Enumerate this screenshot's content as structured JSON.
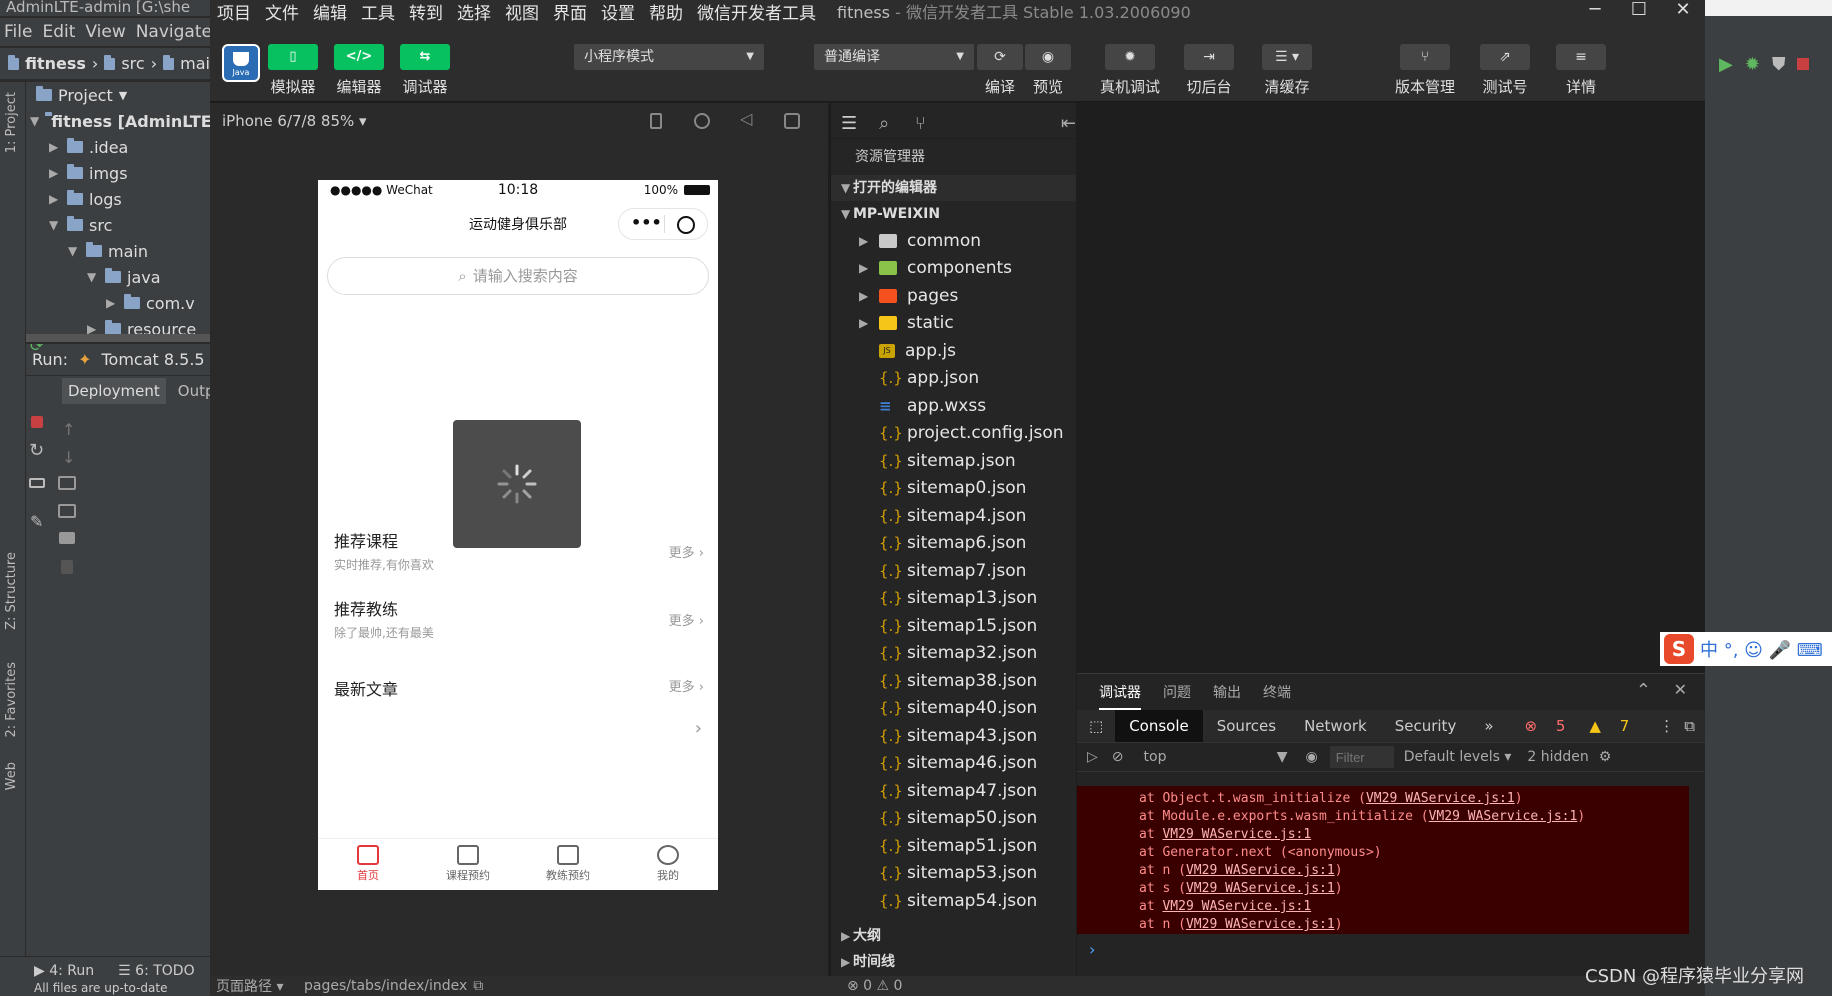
{
  "ij": {
    "titlebar": "AdminLTE-admin [G:\\she",
    "menu": [
      "File",
      "Edit",
      "View",
      "Navigate"
    ],
    "breadcrumb": [
      "fitness",
      "src",
      "mai"
    ],
    "side_labels": [
      "1: Project",
      "Z: Structure",
      "2: Favorites",
      "Web"
    ],
    "project_header": "Project",
    "tree": [
      {
        "label": "fitness [AdminLTE",
        "indent": 0,
        "open": true,
        "bold": true
      },
      {
        "label": ".idea",
        "indent": 1,
        "open": false
      },
      {
        "label": "imgs",
        "indent": 1,
        "open": false
      },
      {
        "label": "logs",
        "indent": 1,
        "open": false
      },
      {
        "label": "src",
        "indent": 1,
        "open": true
      },
      {
        "label": "main",
        "indent": 2,
        "open": true
      },
      {
        "label": "java",
        "indent": 3,
        "open": true
      },
      {
        "label": "com.v",
        "indent": 4,
        "open": false
      },
      {
        "label": "resource",
        "indent": 3,
        "open": false
      }
    ],
    "run_label": "Run:",
    "run_config": "Tomcat 8.5.5",
    "run_tabs": [
      "Deployment",
      "Outpu"
    ],
    "bottom_tabs": [
      "4: Run",
      "6: TODO"
    ],
    "bottom_status": "All files are up-to-date"
  },
  "wx": {
    "menu": [
      "项目",
      "文件",
      "编辑",
      "工具",
      "转到",
      "选择",
      "视图",
      "界面",
      "设置",
      "帮助",
      "微信开发者工具"
    ],
    "title": "fitness",
    "title_sub": " - 微信开发者工具 Stable 1.03.2006090",
    "avatar_text": "Java",
    "toolbar": {
      "simulator": "模拟器",
      "editor": "编辑器",
      "debugger": "调试器",
      "mode_select": "小程序模式",
      "compile_select": "普通编译",
      "compile": "编译",
      "preview": "预览",
      "real_debug": "真机调试",
      "background": "切后台",
      "clear_cache": "清缓存",
      "version": "版本管理",
      "test_account": "测试号",
      "details": "详情"
    },
    "simulator": {
      "device": "iPhone 6/7/8 85% ▾"
    },
    "phone": {
      "carrier": "●●●●● WeChat",
      "time": "10:18",
      "battery": "100%",
      "nav_title": "运动健身俱乐部",
      "search_placeholder": "请输入搜索内容",
      "sections": [
        {
          "title": "推荐课程",
          "subtitle": "实时推荐,有你喜欢",
          "more": "更多"
        },
        {
          "title": "推荐教练",
          "subtitle": "除了最帅,还有最美",
          "more": "更多"
        },
        {
          "title": "最新文章",
          "subtitle": "",
          "more": "更多"
        }
      ],
      "tabs": [
        "首页",
        "课程预约",
        "教练预约",
        "我的"
      ]
    },
    "explorer": {
      "title": "资源管理器",
      "open_editors": "打开的编辑器",
      "project": "MP-WEIXIN",
      "folders": [
        "common",
        "components",
        "pages",
        "static"
      ],
      "folder_colors": [
        "#c9c9c9",
        "#8bc34a",
        "#f4511e",
        "#f5c518"
      ],
      "files": [
        {
          "name": "app.js",
          "type": "js"
        },
        {
          "name": "app.json",
          "type": "json"
        },
        {
          "name": "app.wxss",
          "type": "wxss"
        },
        {
          "name": "project.config.json",
          "type": "json"
        },
        {
          "name": "sitemap.json",
          "type": "json"
        },
        {
          "name": "sitemap0.json",
          "type": "json"
        },
        {
          "name": "sitemap4.json",
          "type": "json"
        },
        {
          "name": "sitemap6.json",
          "type": "json"
        },
        {
          "name": "sitemap7.json",
          "type": "json"
        },
        {
          "name": "sitemap13.json",
          "type": "json"
        },
        {
          "name": "sitemap15.json",
          "type": "json"
        },
        {
          "name": "sitemap32.json",
          "type": "json"
        },
        {
          "name": "sitemap38.json",
          "type": "json"
        },
        {
          "name": "sitemap40.json",
          "type": "json"
        },
        {
          "name": "sitemap43.json",
          "type": "json"
        },
        {
          "name": "sitemap46.json",
          "type": "json"
        },
        {
          "name": "sitemap47.json",
          "type": "json"
        },
        {
          "name": "sitemap50.json",
          "type": "json"
        },
        {
          "name": "sitemap51.json",
          "type": "json"
        },
        {
          "name": "sitemap53.json",
          "type": "json"
        },
        {
          "name": "sitemap54.json",
          "type": "json"
        }
      ],
      "outline": "大纲",
      "timeline": "时间线"
    },
    "debugger": {
      "tabs": [
        "调试器",
        "问题",
        "输出",
        "终端"
      ],
      "subtabs": [
        "Console",
        "Sources",
        "Network",
        "Security"
      ],
      "more": "»",
      "errors": "5",
      "warnings": "7",
      "context": "top",
      "filter_placeholder": "Filter",
      "levels": "Default levels ▾",
      "hidden": "2 hidden",
      "log": [
        {
          "pre": "at Object.t.wasm_initialize (",
          "link": "VM29 WAService.js:1",
          "post": ")"
        },
        {
          "pre": "at Module.e.exports.wasm_initialize (",
          "link": "VM29 WAService.js:1",
          "post": ")"
        },
        {
          "pre": "at ",
          "link": "VM29 WAService.js:1",
          "post": ""
        },
        {
          "pre": "at Generator.next (<anonymous>)",
          "link": "",
          "post": ""
        },
        {
          "pre": "at n (",
          "link": "VM29 WAService.js:1",
          "post": ")"
        },
        {
          "pre": "at s (",
          "link": "VM29 WAService.js:1",
          "post": ")"
        },
        {
          "pre": "at ",
          "link": "VM29 WAService.js:1",
          "post": ""
        },
        {
          "pre": "at n (",
          "link": "VM29 WAService.js:1",
          "post": ")"
        }
      ],
      "prompt": "›"
    },
    "status": {
      "page_path_label": "页面路径 ▾",
      "page_path": "pages/tabs/index/index",
      "problems": "⊗ 0 ⚠ 0"
    }
  },
  "ime": {
    "logo": "S",
    "text": "中 °, ☺ 🎤 ⌨"
  },
  "watermark": "CSDN @程序猿毕业分享网"
}
